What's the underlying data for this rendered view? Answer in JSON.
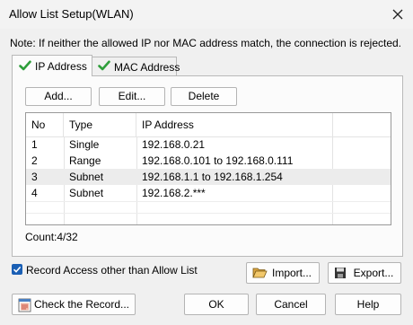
{
  "window": {
    "title": "Allow List Setup(WLAN)",
    "close_label": "✕"
  },
  "note": "Note: If neither the allowed IP nor MAC address match, the connection is rejected.",
  "tabs": [
    {
      "label": "IP Address"
    },
    {
      "label": "MAC Address"
    }
  ],
  "toolbar": {
    "add_label": "Add...",
    "edit_label": "Edit...",
    "delete_label": "Delete"
  },
  "table": {
    "headers": [
      "No",
      "Type",
      "IP Address"
    ],
    "rows": [
      {
        "no": "1",
        "type": "Single",
        "ip": "192.168.0.21"
      },
      {
        "no": "2",
        "type": "Range",
        "ip": "192.168.0.101 to 192.168.0.111"
      },
      {
        "no": "3",
        "type": "Subnet",
        "ip": "192.168.1.1 to 192.168.1.254"
      },
      {
        "no": "4",
        "type": "Subnet",
        "ip": "192.168.2.***"
      }
    ]
  },
  "count": "Count:4/32",
  "record_access": {
    "label": "Record Access other than Allow List",
    "checked": true
  },
  "buttons": {
    "import_label": "Import...",
    "export_label": "Export...",
    "check_record_label": "Check the Record...",
    "ok_label": "OK",
    "cancel_label": "Cancel",
    "help_label": "Help"
  },
  "icons": {
    "tab_check": "check-icon",
    "import": "folder-open-icon",
    "export": "save-icon",
    "check_record": "record-log-icon",
    "checkbox": "checkbox-checked-icon"
  },
  "colors": {
    "check_green": "#2e9e3a",
    "checkbox_blue": "#1a5fb4",
    "selected_row": "#ececec"
  }
}
